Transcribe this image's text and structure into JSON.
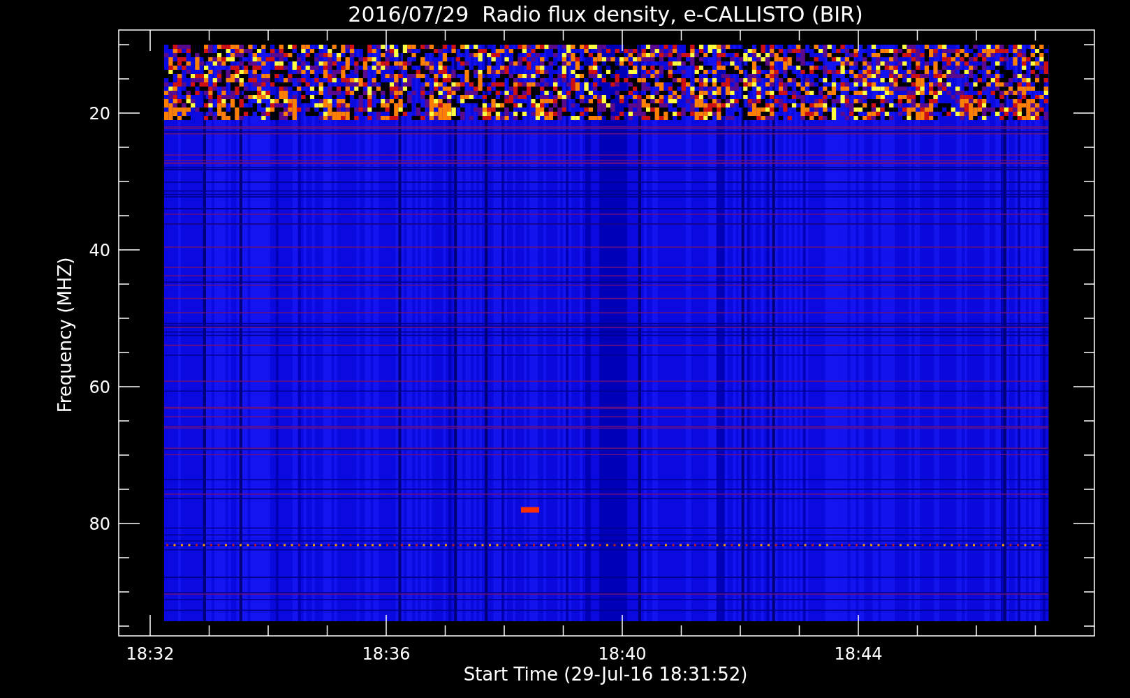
{
  "title": "2016/07/29  Radio flux density, e-CALLISTO (BIR)",
  "y_axis": {
    "label": "Frequency (MHZ)",
    "ticks": [
      "20",
      "40",
      "60",
      "80"
    ]
  },
  "x_axis": {
    "label": "Start Time (29-Jul-16 18:31:52)",
    "ticks": [
      "18:32",
      "18:36",
      "18:40",
      "18:44"
    ]
  }
}
